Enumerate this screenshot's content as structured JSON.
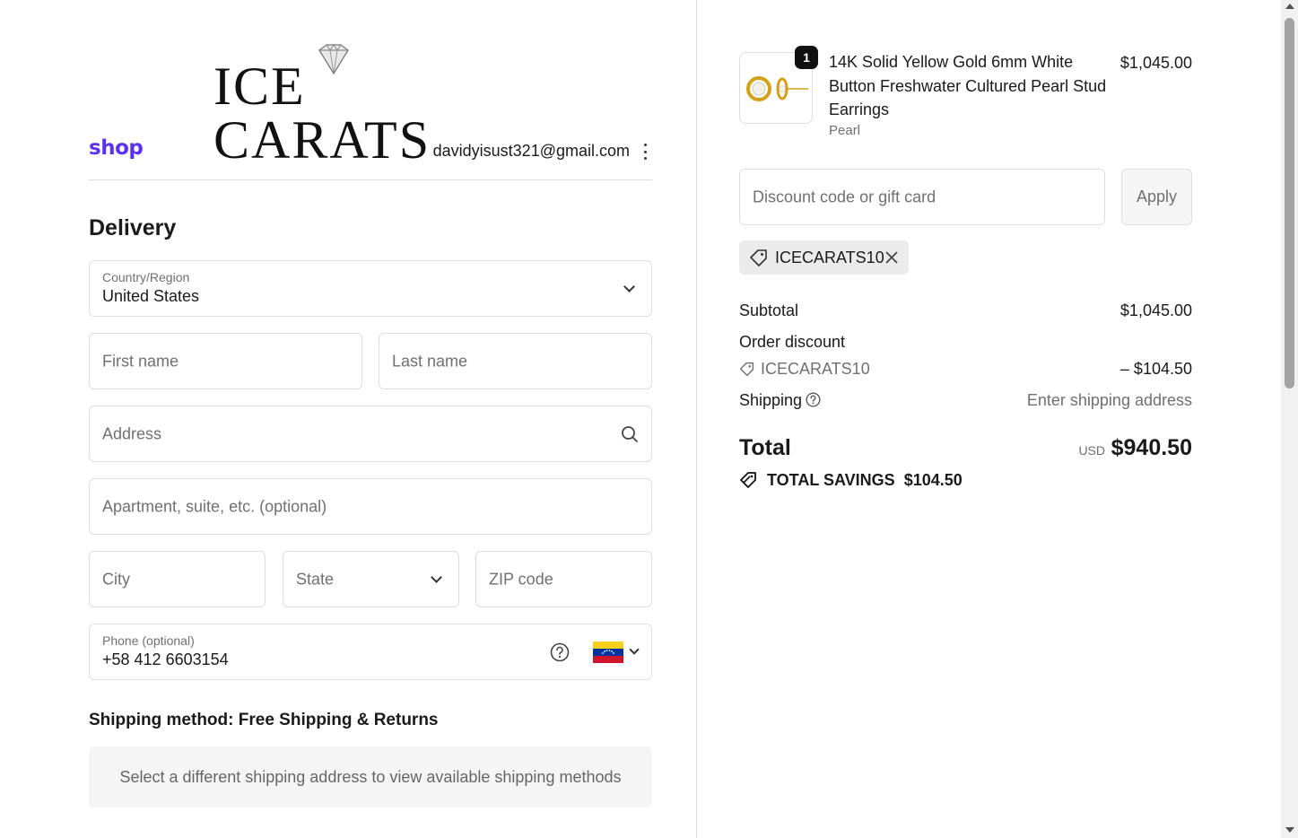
{
  "brand": {
    "logo_text": "ICE CARATS",
    "shop_logo": "shop"
  },
  "account": {
    "email": "davidyisust321@gmail.com"
  },
  "delivery": {
    "heading": "Delivery",
    "country_label": "Country/Region",
    "country_value": "United States",
    "first_name_placeholder": "First name",
    "last_name_placeholder": "Last name",
    "address_placeholder": "Address",
    "apartment_placeholder": "Apartment, suite, etc. (optional)",
    "city_placeholder": "City",
    "state_placeholder": "State",
    "zip_placeholder": "ZIP code",
    "phone_label": "Phone (optional)",
    "phone_value": "+58 412 6603154",
    "phone_flag": "venezuela-flag-icon"
  },
  "shipping_method": {
    "heading": "Shipping method: Free Shipping & Returns",
    "notice": "Select a different shipping address to view available shipping methods"
  },
  "cart": {
    "item": {
      "quantity": "1",
      "name": "14K Solid Yellow Gold 6mm White Button Freshwater Cultured Pearl Stud Earrings",
      "variant": "Pearl",
      "price": "$1,045.00"
    },
    "discount_placeholder": "Discount code or gift card",
    "apply_label": "Apply",
    "applied_code": "ICECARATS10"
  },
  "summary": {
    "subtotal_label": "Subtotal",
    "subtotal_value": "$1,045.00",
    "order_discount_label": "Order discount",
    "discount_code": "ICECARATS10",
    "discount_value": "– $104.50",
    "shipping_label": "Shipping",
    "shipping_value": "Enter shipping address",
    "total_label": "Total",
    "currency": "USD",
    "total_value": "$940.50",
    "savings_label": "TOTAL SAVINGS",
    "savings_value": "$104.50"
  },
  "colors": {
    "shop_purple": "#5a31f4",
    "border": "#dedede",
    "muted": "#707070"
  }
}
